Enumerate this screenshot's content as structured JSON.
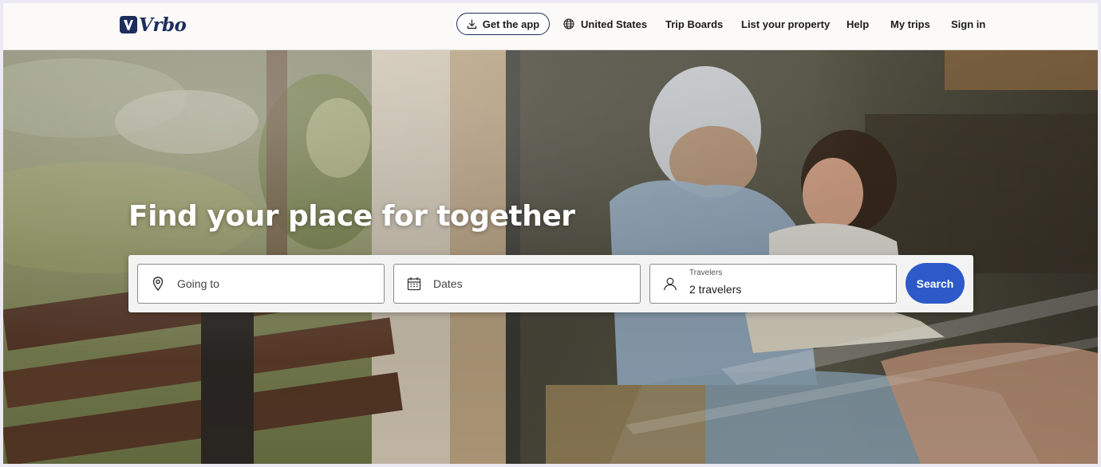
{
  "brand": {
    "name": "Vrbo",
    "color": "#1e2d5c"
  },
  "header": {
    "get_app": {
      "label": "Get the app",
      "icon": "download-icon"
    },
    "region": {
      "label": "United States",
      "icon": "globe-icon"
    },
    "links": [
      {
        "id": "trip-boards",
        "label": "Trip Boards"
      },
      {
        "id": "list-property",
        "label": "List your property"
      },
      {
        "id": "help",
        "label": "Help"
      },
      {
        "id": "my-trips",
        "label": "My trips"
      },
      {
        "id": "sign-in",
        "label": "Sign in"
      }
    ]
  },
  "hero": {
    "title": "Find your place for together"
  },
  "search": {
    "destination": {
      "placeholder": "Going to",
      "icon": "map-pin-icon"
    },
    "dates": {
      "placeholder": "Dates",
      "icon": "calendar-icon"
    },
    "travelers": {
      "label": "Travelers",
      "value": "2 travelers",
      "icon": "person-icon"
    },
    "button_label": "Search",
    "button_color": "#2d5ac8"
  }
}
